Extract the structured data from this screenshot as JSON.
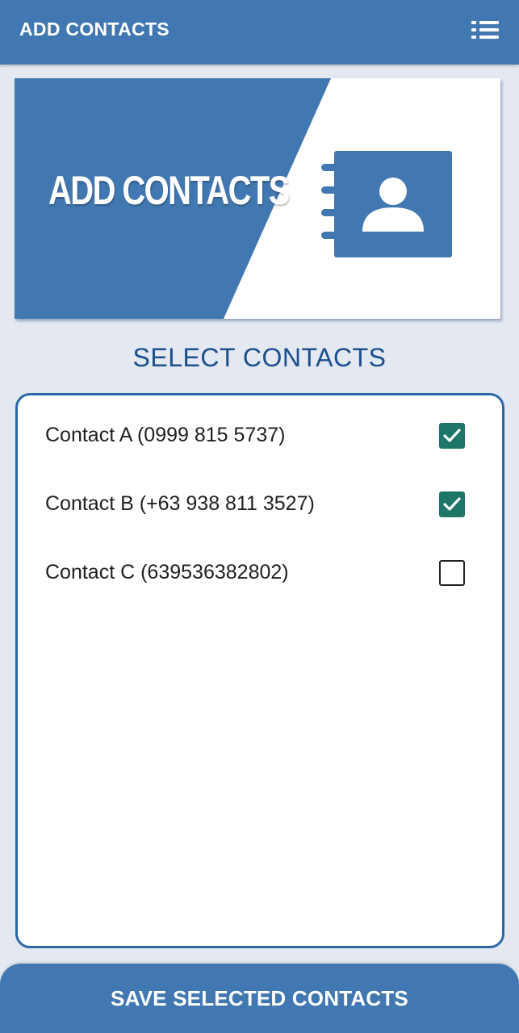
{
  "app_bar": {
    "title": "ADD CONTACTS",
    "menu_icon": "list-menu-icon"
  },
  "banner": {
    "title": "ADD CONTACTS",
    "icon": "address-book-icon"
  },
  "section_title": "SELECT CONTACTS",
  "contacts": [
    {
      "label": "Contact A (0999 815 5737)",
      "checked": true
    },
    {
      "label": "Contact B (+63 938 811 3527)",
      "checked": true
    },
    {
      "label": "Contact C (639536382802)",
      "checked": false
    }
  ],
  "save_button": {
    "label": "SAVE SELECTED CONTACTS"
  },
  "colors": {
    "primary": "#4178b1",
    "checkbox_checked": "#1e7668",
    "background": "#e3e8f1",
    "section_title": "#1b4f8e"
  }
}
